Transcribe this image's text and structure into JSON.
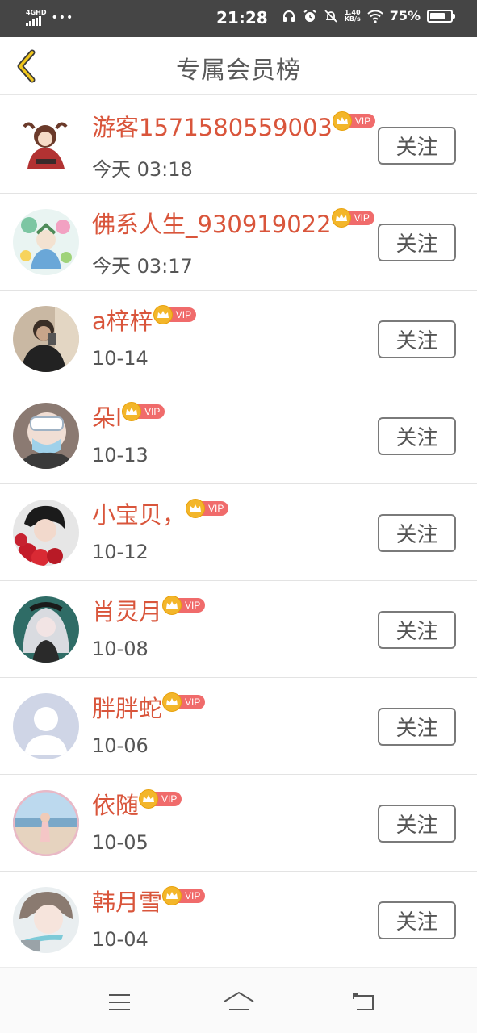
{
  "status_bar": {
    "network": "4GHD",
    "dots": "•••",
    "time": "21:28",
    "speed_value": "1.40",
    "speed_unit": "KB/s",
    "battery_percent_text": "75%",
    "battery_level": 0.75
  },
  "header": {
    "title": "专属会员榜",
    "back_icon": "back-chevron-icon"
  },
  "vip_label": "VIP",
  "follow_label": "关注",
  "members": [
    {
      "name": "游客1571580559003",
      "time": "今天 03:18",
      "avatar": "anime-girl-red",
      "vip": true
    },
    {
      "name": "佛系人生_930919022",
      "time": "今天 03:17",
      "avatar": "anime-colorful",
      "vip": true
    },
    {
      "name": "a梓梓",
      "time": "10-14",
      "avatar": "photo-boy-dark",
      "vip": true
    },
    {
      "name": "朵l",
      "time": "10-13",
      "avatar": "photo-mask-goggles",
      "vip": true
    },
    {
      "name": "小宝贝，",
      "time": "10-12",
      "avatar": "photo-girl-roses",
      "vip": true
    },
    {
      "name": "肖灵月",
      "time": "10-08",
      "avatar": "anime-gothic-girl",
      "vip": true
    },
    {
      "name": "胖胖蛇",
      "time": "10-06",
      "avatar": "default-silhouette",
      "vip": true
    },
    {
      "name": "依随",
      "time": "10-05",
      "avatar": "photo-beach",
      "vip": true
    },
    {
      "name": "韩月雪",
      "time": "10-04",
      "avatar": "photo-girl-light",
      "vip": true
    }
  ],
  "nav": {
    "menu_icon": "menu-icon",
    "home_icon": "home-icon",
    "back_icon": "back-arrow-icon"
  },
  "colors": {
    "name": "#d9553b",
    "vip_tag": "#f06b6b",
    "crown": "#f3b62a",
    "status_bar": "#454545"
  }
}
